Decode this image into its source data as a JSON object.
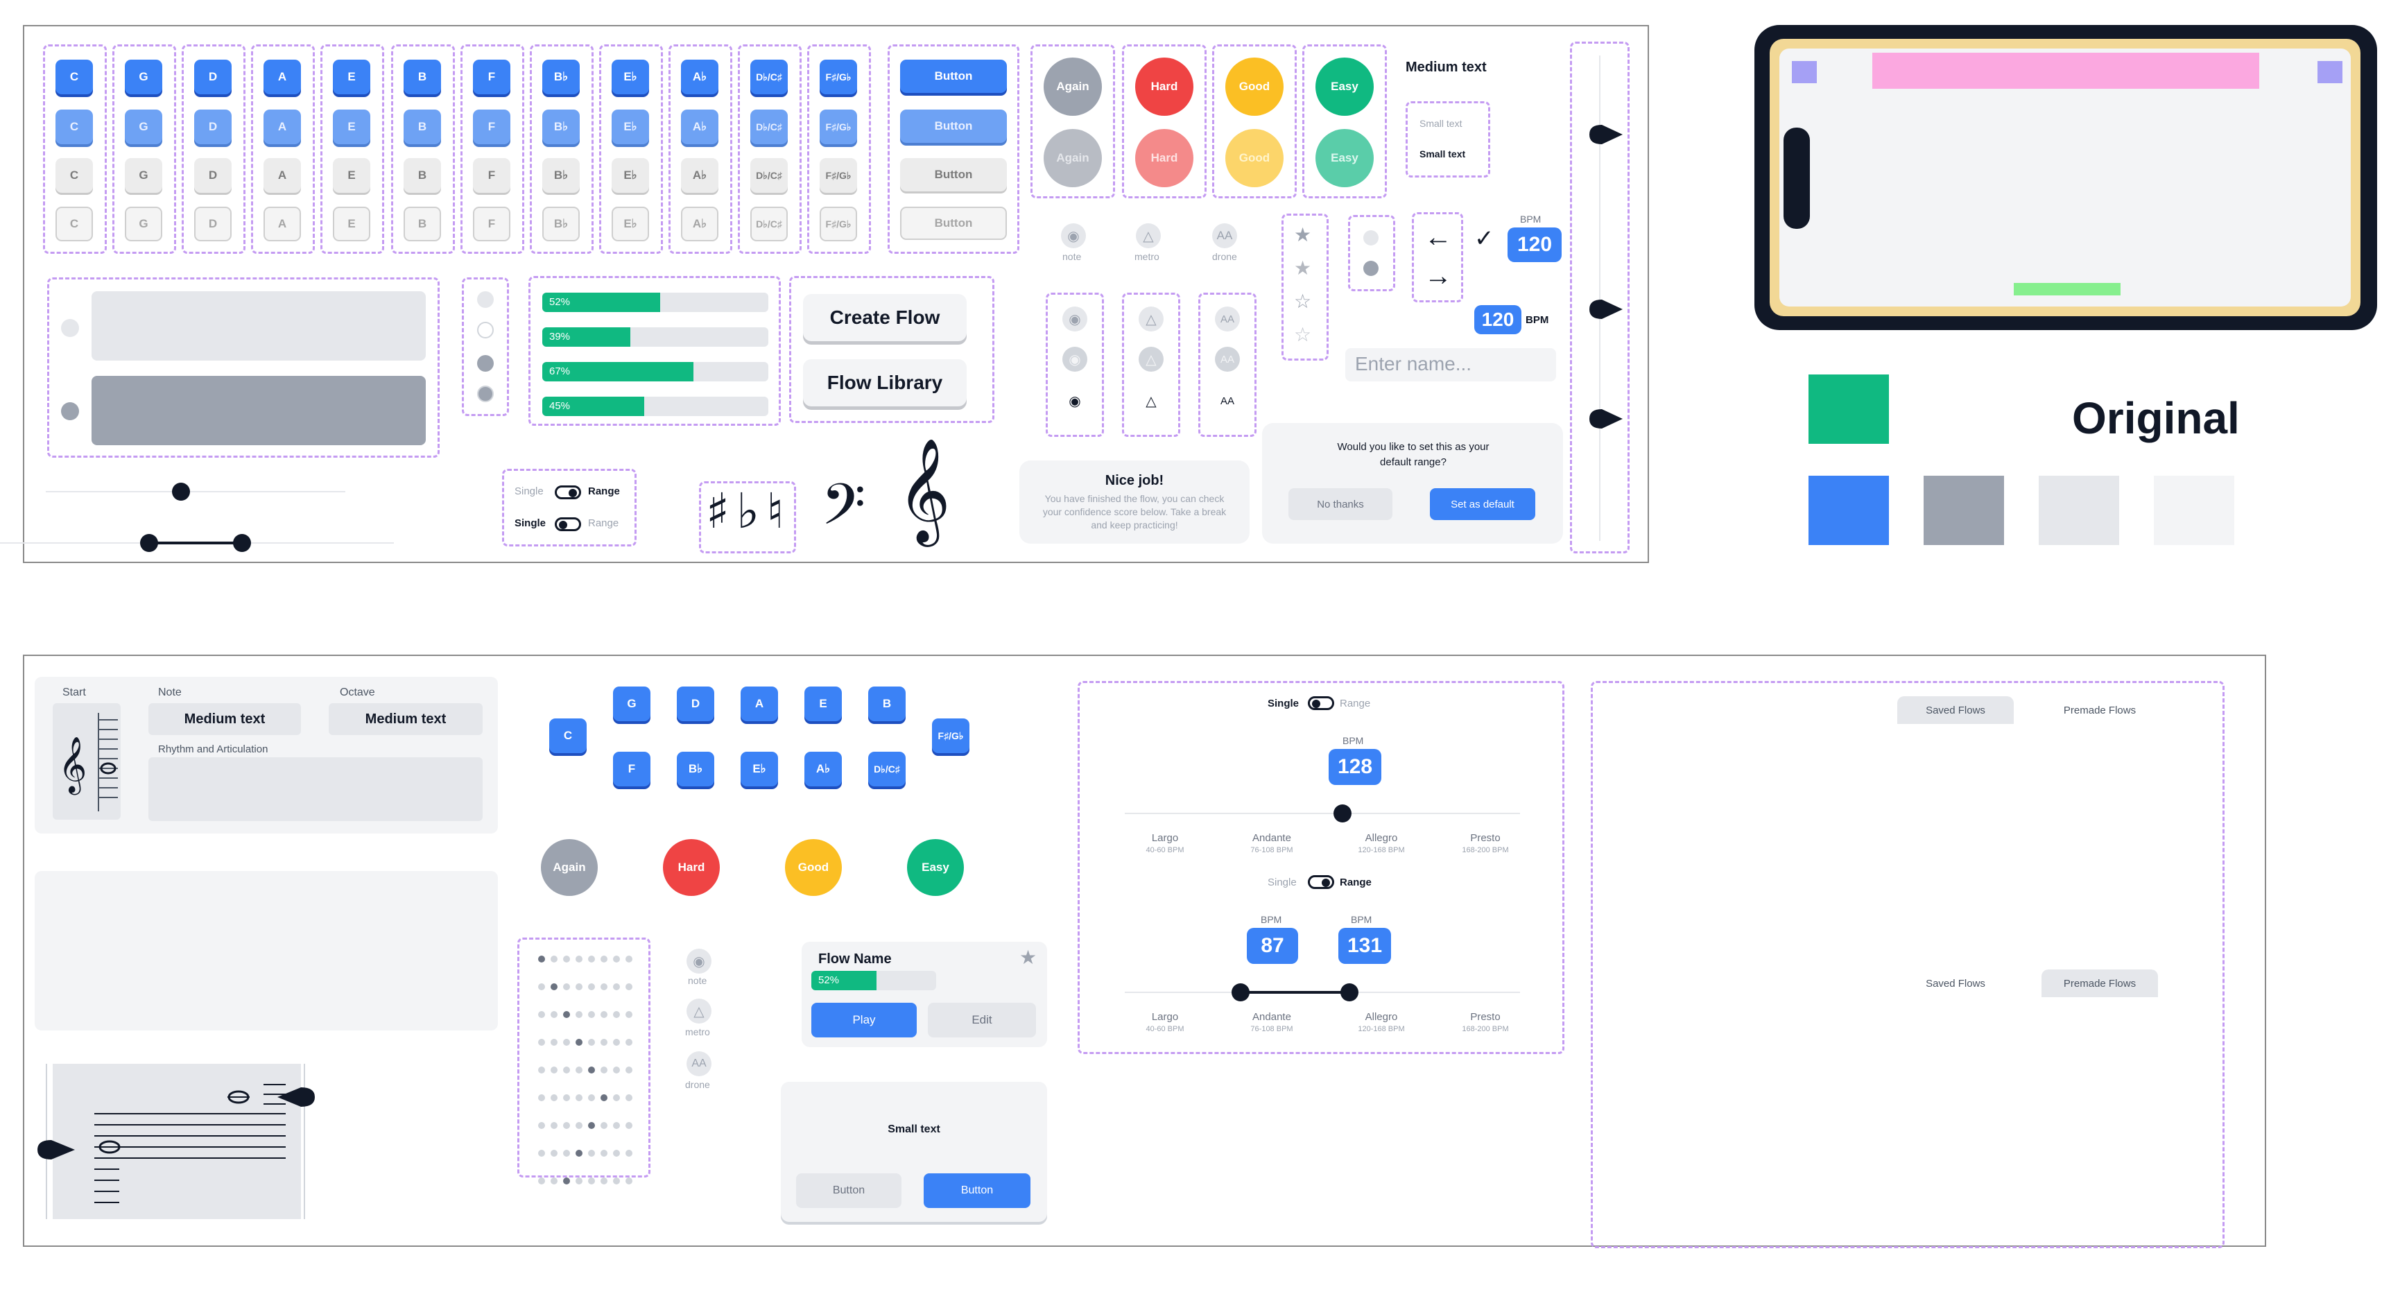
{
  "keys": {
    "notes": [
      "C",
      "G",
      "D",
      "A",
      "E",
      "B",
      "F",
      "B♭",
      "E♭",
      "A♭",
      "D♭/C♯",
      "F♯/G♭"
    ]
  },
  "buttons": {
    "label": "Button"
  },
  "ratings": {
    "again": "Again",
    "hard": "Hard",
    "good": "Good",
    "easy": "Easy"
  },
  "text_samples": {
    "medium": "Medium text",
    "small": "Small text"
  },
  "tools": {
    "note": "note",
    "metro": "metro",
    "drone": "drone"
  },
  "bpm": {
    "label": "BPM",
    "value": "120"
  },
  "name_input": {
    "placeholder": "Enter name..."
  },
  "progress": [
    {
      "value": 52,
      "label": "52%"
    },
    {
      "value": 39,
      "label": "39%"
    },
    {
      "value": 67,
      "label": "67%"
    },
    {
      "value": 45,
      "label": "45%"
    }
  ],
  "flow_buttons": {
    "create": "Create Flow",
    "library": "Flow Library"
  },
  "toggles": {
    "single": "Single",
    "range": "Range"
  },
  "accidentals": "♯ ♭ ♮",
  "clefs": {
    "bass": "𝄢",
    "treble": "𝄞"
  },
  "nice_job": {
    "title": "Nice job!",
    "body": "You have finished the flow, you can check your confidence score below. Take a break and keep practicing!"
  },
  "default_range": {
    "question": "Would you like to set this as your default range?",
    "no": "No thanks",
    "yes": "Set as default"
  },
  "legend": {
    "title": "Original"
  },
  "colors": {
    "green": "#10b981",
    "blue": "#3b82f6",
    "gray": "#9ca3af",
    "light_gray": "#e5e7eb",
    "lighter_gray": "#f3f4f6",
    "hard": "#ef4444",
    "good": "#fbbf24",
    "device_frame": "#111827",
    "device_border": "#f1d99b",
    "pink": "#fba8e0",
    "purple": "#a5a0f5"
  },
  "editor": {
    "start": "Start",
    "note": "Note",
    "octave": "Octave",
    "note_value": "Medium text",
    "octave_value": "Medium text",
    "rhythm": "Rhythm and Articulation"
  },
  "flow_card": {
    "name": "Flow Name",
    "progress_label": "52%",
    "progress": 52,
    "play": "Play",
    "edit": "Edit"
  },
  "dialog": {
    "text": "Small text",
    "cancel": "Button",
    "confirm": "Button"
  },
  "tempo": {
    "bpm_label": "BPM",
    "single_value": "128",
    "range_low": "87",
    "range_high": "131",
    "markings": [
      {
        "name": "Largo",
        "range": "40-60 BPM"
      },
      {
        "name": "Andante",
        "range": "76-108 BPM"
      },
      {
        "name": "Allegro",
        "range": "120-168 BPM"
      },
      {
        "name": "Presto",
        "range": "168-200 BPM"
      }
    ]
  },
  "flows_tabs": {
    "saved": "Saved Flows",
    "premade": "Premade Flows"
  }
}
